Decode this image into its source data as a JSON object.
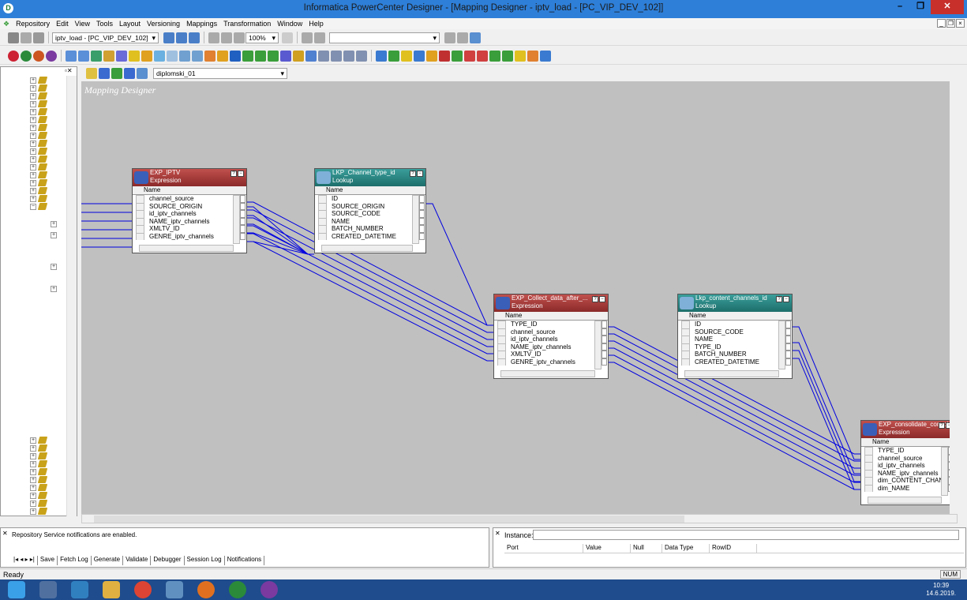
{
  "window": {
    "title": "Informatica PowerCenter Designer - [Mapping Designer - iptv_load - [PC_VIP_DEV_102]]",
    "app_icon": "D"
  },
  "menu": [
    "Repository",
    "Edit",
    "View",
    "Tools",
    "Layout",
    "Versioning",
    "Mappings",
    "Transformation",
    "Window",
    "Help"
  ],
  "toolbar1": {
    "mapping_combo": "iptv_load - [PC_VIP_DEV_102]",
    "zoom": "100%"
  },
  "toolbar3": {
    "mapplet_combo": "diplomski_01"
  },
  "designer": {
    "label": "Mapping Designer"
  },
  "transformations": [
    {
      "id": "exp-iptv",
      "title": "EXP_IPTV",
      "type": "Expression",
      "color": "red",
      "col": "Name",
      "rows": [
        "channel_source",
        "SOURCE_ORIGIN",
        "id_iptv_channels",
        "NAME_iptv_channels",
        "XMLTV_ID",
        "GENRE_iptv_channels"
      ]
    },
    {
      "id": "lkp-channel-type",
      "title": "LKP_Channel_type_id",
      "type": "Lookup",
      "color": "teal",
      "col": "Name",
      "rows": [
        "ID",
        "SOURCE_ORIGIN",
        "SOURCE_CODE",
        "NAME",
        "BATCH_NUMBER",
        "CREATED_DATETIME"
      ]
    },
    {
      "id": "exp-collect",
      "title": "EXP_Collect_data_after_...",
      "type": "Expression",
      "color": "red",
      "col": "Name",
      "rows": [
        "TYPE_ID",
        "channel_source",
        "id_iptv_channels",
        "NAME_iptv_channels",
        "XMLTV_ID",
        "GENRE_iptv_channels"
      ]
    },
    {
      "id": "lkp-content",
      "title": "Lkp_content_channels_id",
      "type": "Lookup",
      "color": "teal",
      "col": "Name",
      "rows": [
        "ID",
        "SOURCE_CODE",
        "NAME",
        "TYPE_ID",
        "BATCH_NUMBER",
        "CREATED_DATETIME"
      ]
    },
    {
      "id": "exp-consolidate",
      "title": "EXP_consolidate_con_ch",
      "type": "Expression",
      "color": "red",
      "col": "Name",
      "rows": [
        "TYPE_ID",
        "channel_source",
        "id_iptv_channels",
        "NAME_iptv_channels",
        "dim_CONTENT_CHANNE",
        "dim_NAME"
      ]
    }
  ],
  "output": {
    "message": "Repository Service notifications are enabled.",
    "tabs": [
      "Save",
      "Fetch Log",
      "Generate",
      "Validate",
      "Debugger",
      "Session Log",
      "Notifications"
    ]
  },
  "instance": {
    "label": "Instance:",
    "columns": [
      "Port",
      "Value",
      "Null",
      "Data Type",
      "RowID"
    ]
  },
  "status": {
    "text": "Ready",
    "num": "NUM"
  },
  "clock": {
    "time": "10:39",
    "date": "14.6.2019."
  },
  "colors": {
    "titlebar": "#2e7fd8",
    "canvas": "#c0c0c0",
    "link": "#0000e0",
    "expression": "#8b2a2a",
    "lookup": "#1d6e6b",
    "taskbar": "#1f4c8c"
  }
}
